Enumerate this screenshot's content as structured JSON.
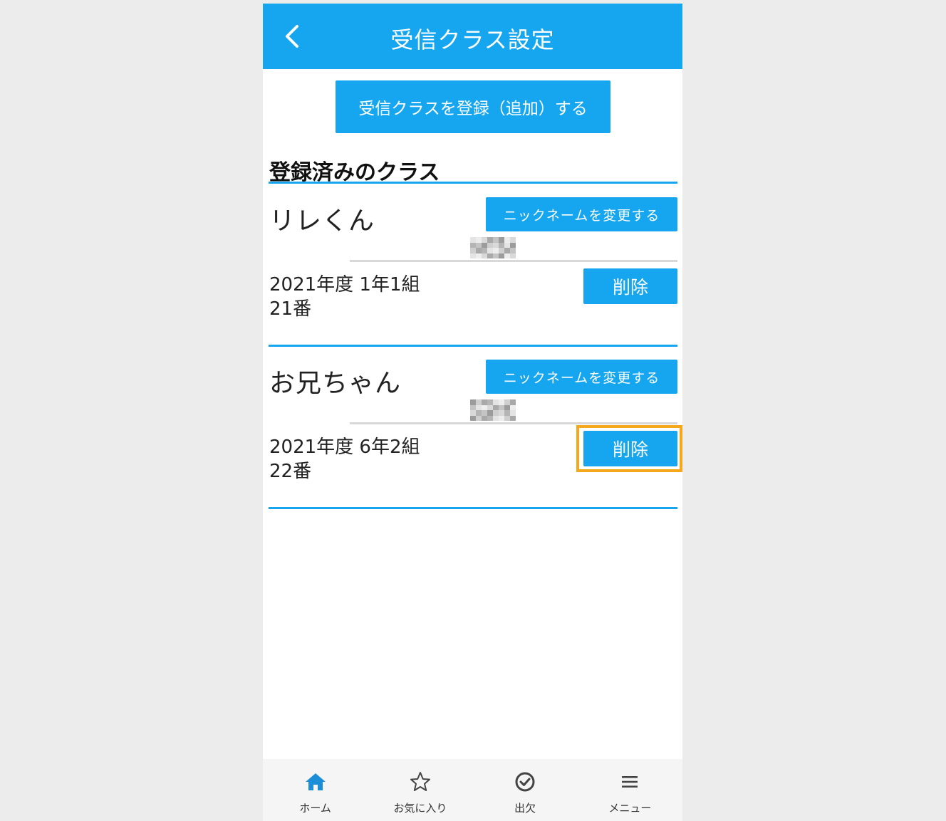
{
  "header": {
    "title": "受信クラス設定",
    "back_icon": "chevron-left-icon"
  },
  "add_button": {
    "label": "受信クラスを登録（追加）する"
  },
  "section": {
    "heading": "登録済みのクラス"
  },
  "classes": [
    {
      "nickname": "リレくん",
      "nickname_button": "ニックネームを変更する",
      "class_line1": "2021年度  1年1組",
      "class_line2": "21番",
      "delete_button": "削除",
      "highlighted": false
    },
    {
      "nickname": "お兄ちゃん",
      "nickname_button": "ニックネームを変更する",
      "class_line1": "2021年度 6年2組",
      "class_line2": "22番",
      "delete_button": "削除",
      "highlighted": true
    }
  ],
  "tabbar": {
    "items": [
      {
        "label": "ホーム",
        "icon": "home-icon",
        "active": true
      },
      {
        "label": "お気に入り",
        "icon": "star-icon",
        "active": false
      },
      {
        "label": "出欠",
        "icon": "check-circle-icon",
        "active": false
      },
      {
        "label": "メニュー",
        "icon": "menu-icon",
        "active": false
      }
    ]
  },
  "colors": {
    "accent": "#16a6ef",
    "highlight": "#f5a81c",
    "background": "#ececec"
  }
}
